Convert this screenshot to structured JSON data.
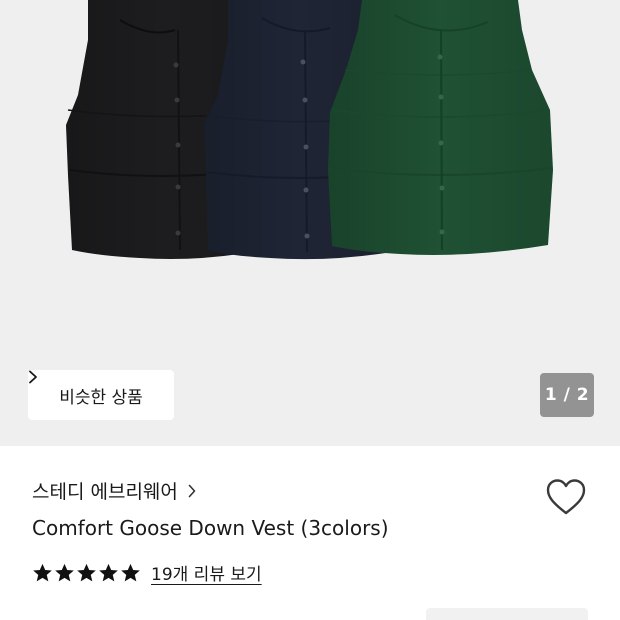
{
  "gallery": {
    "similar_label": "비슷한 상품",
    "counter": "1 / 2",
    "current_page": 1,
    "total_pages": 2,
    "vest_colors": [
      "#1d1d1f",
      "#1f2535",
      "#1f5134"
    ],
    "background_color": "#efefef"
  },
  "product": {
    "brand": "스테디 에브리웨어",
    "title": "Comfort Goose Down Vest (3colors)",
    "rating": 5,
    "max_rating": 5,
    "review_link": "19개 리뷰 보기"
  },
  "icons": {
    "similar_chevron": "chevron-right-icon",
    "brand_chevron": "chevron-right-icon",
    "wishlist": "heart-outline-icon",
    "star": "star-filled-icon"
  }
}
